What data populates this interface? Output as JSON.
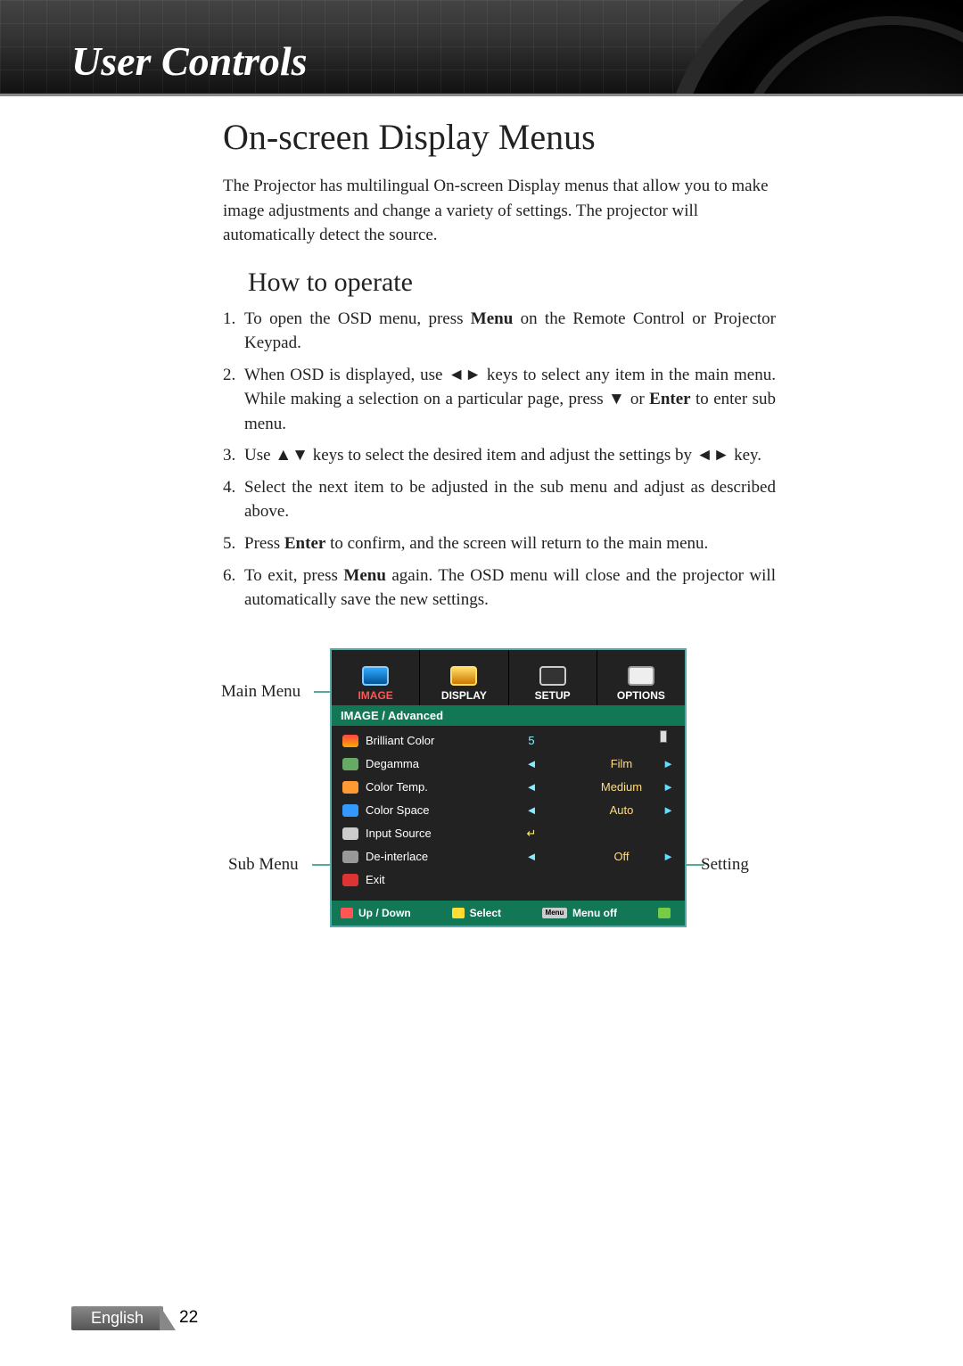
{
  "header_title": "User Controls",
  "h1": "On-screen Display Menus",
  "intro": "The Projector has multilingual On-screen Display menus that allow you to make image adjustments and change a variety of settings. The projector will automatically detect the source.",
  "h2": "How to operate",
  "steps": {
    "s1a": "To open the OSD menu, press ",
    "s1b": "Menu",
    "s1c": " on the Remote Control or Projector Keypad.",
    "s2a": "When OSD is displayed, use ",
    "s2arrows": "◄►",
    "s2b": " keys to select any item in the main menu. While making a selection on a particular page, press ",
    "s2down": "▼",
    "s2c": " or ",
    "s2enter": "Enter",
    "s2d": " to enter sub menu.",
    "s3a": "Use ",
    "s3updown": "▲▼",
    "s3b": " keys to select the desired item and adjust the settings by ",
    "s3lr": "◄►",
    "s3c": " key.",
    "s4": "Select the next item to be adjusted in the sub menu and adjust as described above.",
    "s5a": "Press ",
    "s5enter": "Enter",
    "s5b": " to confirm, and the screen will return to the main menu.",
    "s6a": "To exit, press ",
    "s6menu": "Menu",
    "s6b": " again. The OSD menu will close and the projector will automatically save the new settings."
  },
  "callouts": {
    "main": "Main Menu",
    "sub": "Sub Menu",
    "setting": "Setting"
  },
  "osd": {
    "tabs": [
      "IMAGE",
      "DISPLAY",
      "SETUP",
      "OPTIONS"
    ],
    "breadcrumb": "IMAGE / Advanced",
    "rows": [
      {
        "label": "Brilliant Color",
        "mid": "5",
        "val": "",
        "slider": true
      },
      {
        "label": "Degamma",
        "mid": "◄",
        "val": "Film",
        "arrow": true
      },
      {
        "label": "Color Temp.",
        "mid": "◄",
        "val": "Medium",
        "arrow": true
      },
      {
        "label": "Color Space",
        "mid": "◄",
        "val": "Auto",
        "arrow": true
      },
      {
        "label": "Input Source",
        "mid": "↵",
        "val": "",
        "arrow": false
      },
      {
        "label": "De-interlace",
        "mid": "◄",
        "val": "Off",
        "arrow": true
      },
      {
        "label": "Exit",
        "mid": "",
        "val": "",
        "arrow": false
      }
    ],
    "footer": {
      "updown": "Up / Down",
      "select": "Select",
      "menuoff": "Menu off",
      "menu_btn": "Menu"
    }
  },
  "footer": {
    "language": "English",
    "page": "22"
  }
}
